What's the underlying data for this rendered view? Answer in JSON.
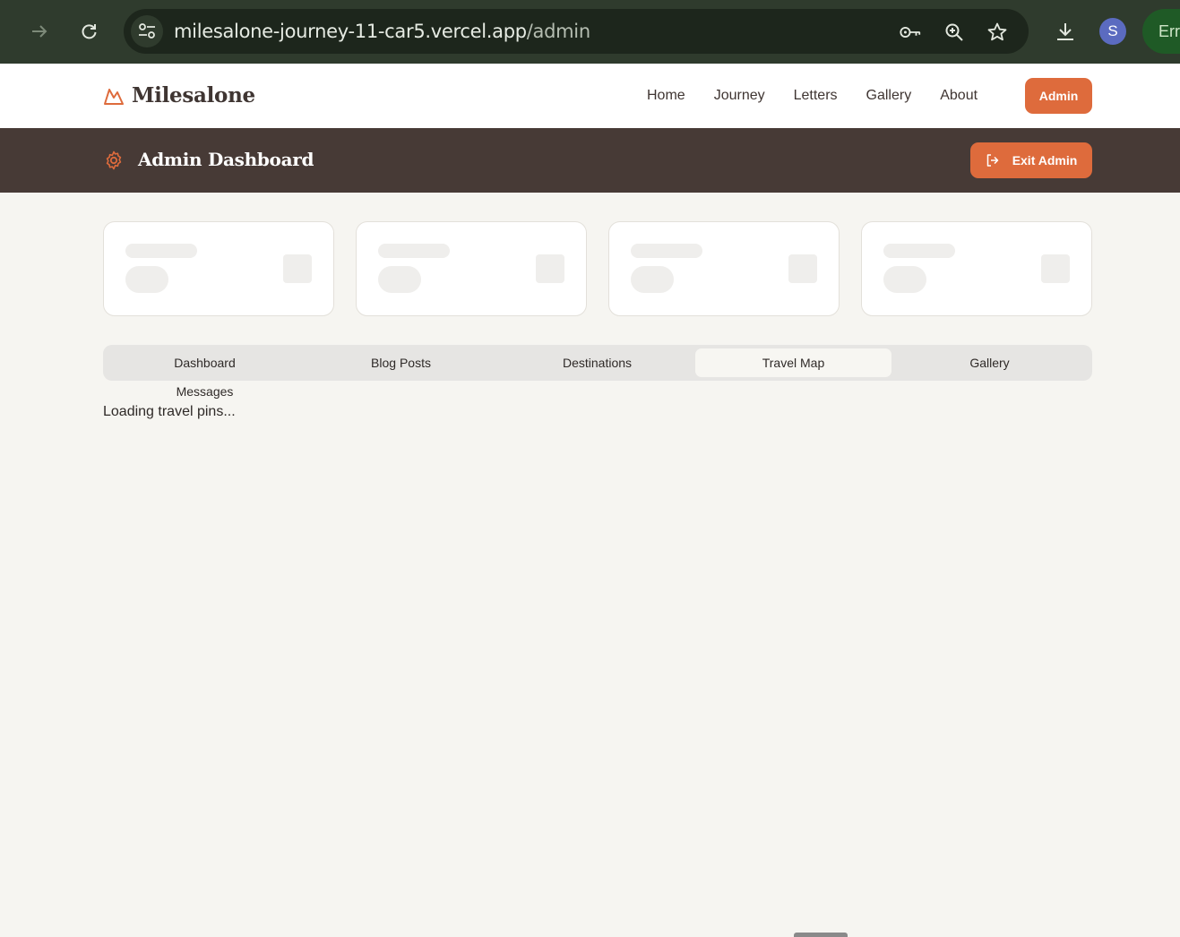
{
  "browser": {
    "url_host": "milesalone-journey-11-car5.vercel.app",
    "url_path": "/admin",
    "profile_initial": "S",
    "error_chip": "Erro",
    "icons": [
      "forward-icon",
      "reload-icon",
      "site-info-icon",
      "password-key-icon",
      "zoom-icon",
      "bookmark-star-icon",
      "download-icon"
    ]
  },
  "header": {
    "brand": "Milesalone",
    "nav": [
      "Home",
      "Journey",
      "Letters",
      "Gallery",
      "About"
    ],
    "admin_label": "Admin"
  },
  "admin_bar": {
    "title": "Admin Dashboard",
    "exit_label": "Exit Admin"
  },
  "tabs": {
    "items": [
      "Dashboard",
      "Blog Posts",
      "Destinations",
      "Travel Map",
      "Gallery"
    ],
    "overflow": "Messages",
    "active": "Travel Map"
  },
  "content": {
    "loading_text": "Loading travel pins..."
  },
  "colors": {
    "accent": "#de6b3c",
    "admin_bar": "#473a36",
    "page_bg": "#f6f5f1",
    "chrome_bg": "#2f3b2d"
  }
}
